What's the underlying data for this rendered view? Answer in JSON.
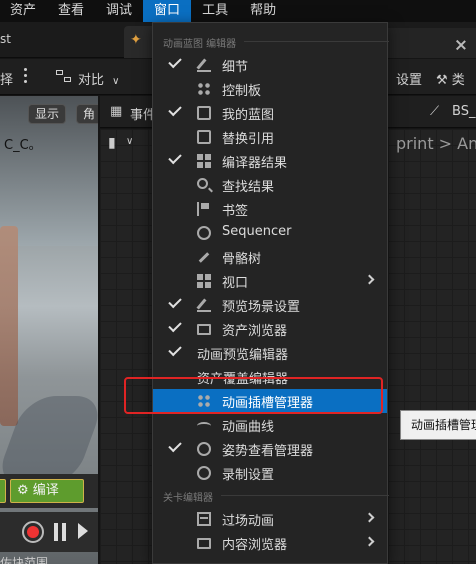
{
  "menubar": {
    "items": [
      "资产",
      "查看",
      "调试",
      "窗口",
      "工具",
      "帮助"
    ],
    "active": "窗口"
  },
  "tabs": {
    "left_fragment": "st"
  },
  "toolbar": {
    "left_fragment": "择",
    "diff_label": "对比",
    "settings_fragment": "设置",
    "right_fragment": "类"
  },
  "viewport": {
    "show_label": "显示",
    "angle_fragment": "角",
    "char_label": "C_C。",
    "compile_label": "编译",
    "bottom_fragment": "佐块范围"
  },
  "graph": {
    "events_tab": "事件",
    "right_tab": "BS_",
    "breadcrumb": "print > An"
  },
  "tooltip": {
    "text": "动画插槽管理"
  },
  "menu": {
    "sections": [
      {
        "title": "动画蓝图 编辑器",
        "items": [
          {
            "label": "细节",
            "checked": true,
            "icon": "pen-icon",
            "submenu": false
          },
          {
            "label": "控制板",
            "checked": false,
            "icon": "palette-icon",
            "submenu": false
          },
          {
            "label": "我的蓝图",
            "checked": true,
            "icon": "book-icon",
            "submenu": false
          },
          {
            "label": "替换引用",
            "checked": false,
            "icon": "replace-icon",
            "submenu": false
          },
          {
            "label": "编译器结果",
            "checked": true,
            "icon": "compiler-icon",
            "submenu": false
          },
          {
            "label": "查找结果",
            "checked": false,
            "icon": "search-icon",
            "submenu": false
          },
          {
            "label": "书签",
            "checked": false,
            "icon": "bookmark-icon",
            "submenu": false
          },
          {
            "label": "Sequencer",
            "checked": false,
            "icon": "sequencer-icon",
            "submenu": false
          },
          {
            "label": "骨骼树",
            "checked": false,
            "icon": "bone-icon",
            "submenu": false
          },
          {
            "label": "视口",
            "checked": false,
            "icon": "viewport-icon",
            "submenu": true
          },
          {
            "label": "预览场景设置",
            "checked": true,
            "icon": "scene-icon",
            "submenu": false
          },
          {
            "label": "资产浏览器",
            "checked": true,
            "icon": "folder-icon",
            "submenu": false
          },
          {
            "label": "动画预览编辑器",
            "checked": true,
            "icon": "",
            "submenu": false
          },
          {
            "label": "资产覆盖编辑器",
            "checked": false,
            "icon": "",
            "submenu": false
          },
          {
            "label": "动画插槽管理器",
            "checked": false,
            "icon": "slot-icon",
            "submenu": false,
            "highlighted": true
          },
          {
            "label": "动画曲线",
            "checked": false,
            "icon": "curve-icon",
            "submenu": false
          },
          {
            "label": "姿势查看管理器",
            "checked": true,
            "icon": "pose-icon",
            "submenu": false
          },
          {
            "label": "录制设置",
            "checked": false,
            "icon": "record-icon",
            "submenu": false
          }
        ]
      },
      {
        "title": "关卡编辑器",
        "items": [
          {
            "label": "过场动画",
            "checked": false,
            "icon": "film-icon",
            "submenu": true
          },
          {
            "label": "内容浏览器",
            "checked": false,
            "icon": "folder-icon",
            "submenu": true
          }
        ]
      }
    ]
  },
  "colors": {
    "accent": "#0a6fc2",
    "annotation": "#e02424",
    "compile": "#5e9c2d"
  }
}
